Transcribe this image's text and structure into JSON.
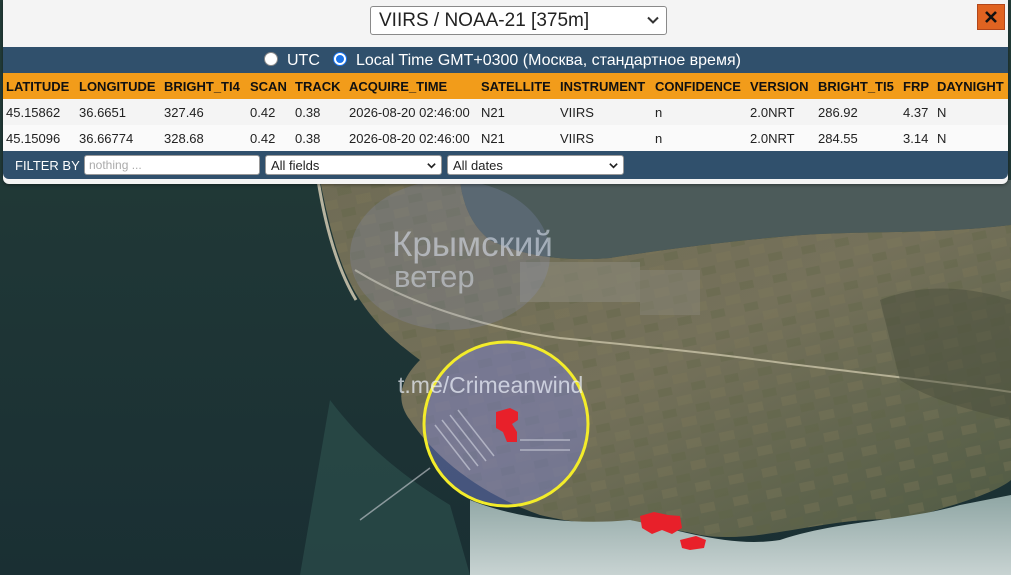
{
  "satellite_select": {
    "value": "VIIRS / NOAA-21 [375m]"
  },
  "close_button": {
    "label": "✕"
  },
  "timezone": {
    "utc_label": "UTC",
    "local_label": "Local Time GMT+0300 (Москва, стандартное время)",
    "selected": "local"
  },
  "table": {
    "headers": [
      "LATITUDE",
      "LONGITUDE",
      "BRIGHT_TI4",
      "SCAN",
      "TRACK",
      "ACQUIRE_TIME",
      "SATELLITE",
      "INSTRUMENT",
      "CONFIDENCE",
      "VERSION",
      "BRIGHT_TI5",
      "FRP",
      "DAYNIGHT"
    ],
    "rows": [
      [
        "45.15862",
        "36.6651",
        "327.46",
        "0.42",
        "0.38",
        "2026-08-20 02:46:00",
        "N21",
        "VIIRS",
        "n",
        "2.0NRT",
        "286.92",
        "4.37",
        "N"
      ],
      [
        "45.15096",
        "36.66774",
        "328.68",
        "0.42",
        "0.38",
        "2026-08-20 02:46:00",
        "N21",
        "VIIRS",
        "n",
        "2.0NRT",
        "284.55",
        "3.14",
        "N"
      ]
    ]
  },
  "filter": {
    "label": "FILTER BY",
    "placeholder": "nothing ...",
    "fields_value": "All fields",
    "dates_value": "All dates"
  },
  "watermark": {
    "title": "Крымский",
    "subtitle": "ветер",
    "url": "t.me/Crimeanwind"
  },
  "colors": {
    "header_orange": "#f29c1a",
    "bar_blue": "#30506c",
    "close_orange": "#e06321",
    "highlight_circle": "#f3ec2a",
    "fire_red": "#e8202a"
  }
}
